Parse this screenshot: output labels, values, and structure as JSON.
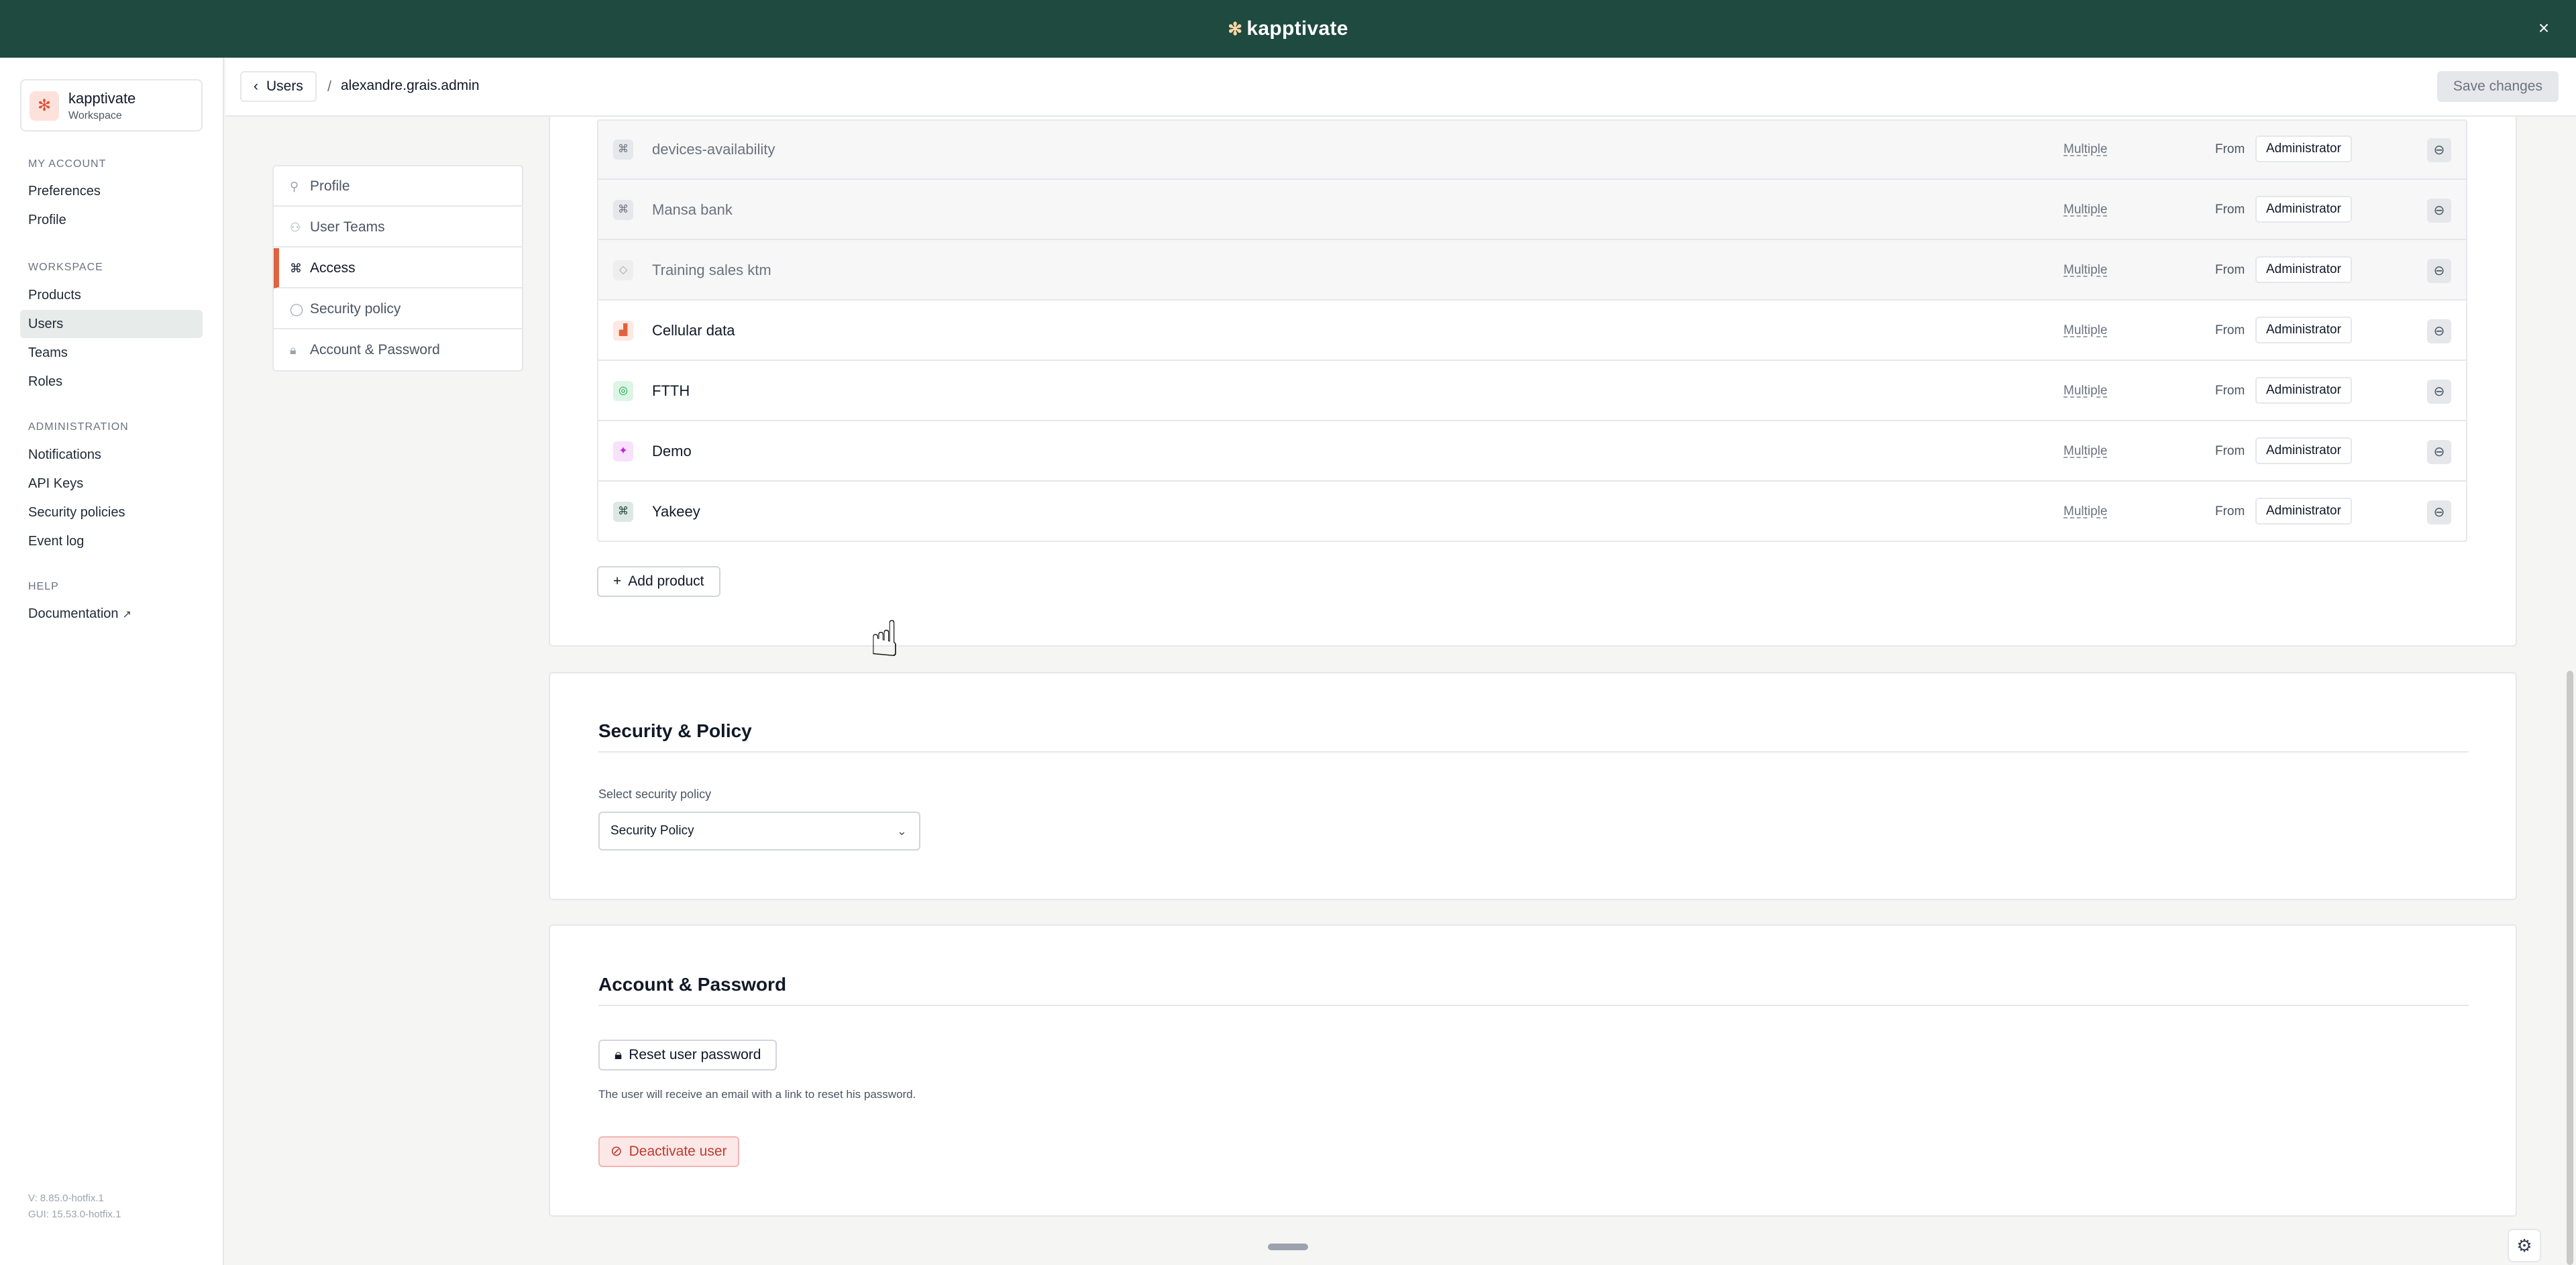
{
  "topbar": {
    "brand": "kapptivate",
    "brand_icon": "asterisk-icon",
    "close_label": "×"
  },
  "sidebar": {
    "workspace": {
      "name": "kapptivate",
      "subtitle": "Workspace"
    },
    "sections": [
      {
        "title": "MY ACCOUNT",
        "items": [
          "Preferences",
          "Profile"
        ]
      },
      {
        "title": "WORKSPACE",
        "items": [
          "Products",
          "Users",
          "Teams",
          "Roles"
        ]
      },
      {
        "title": "ADMINISTRATION",
        "items": [
          "Notifications",
          "API Keys",
          "Security policies",
          "Event log"
        ]
      },
      {
        "title": "HELP",
        "items": [
          "Documentation"
        ]
      }
    ],
    "active_item": "Users",
    "version": "V: 8.85.0-hotfix.1",
    "gui_version": "GUI: 15.53.0-hotfix.1"
  },
  "header": {
    "back_label": "Users",
    "separator": "/",
    "current": "alexandre.grais.admin",
    "save_label": "Save changes"
  },
  "subtabs": [
    {
      "label": "Profile",
      "icon": "user-icon",
      "active": false
    },
    {
      "label": "User Teams",
      "icon": "users-icon",
      "active": false
    },
    {
      "label": "Access",
      "icon": "command-icon",
      "active": true
    },
    {
      "label": "Security policy",
      "icon": "shield-icon",
      "active": false
    },
    {
      "label": "Account & Password",
      "icon": "lock-icon",
      "active": false
    }
  ],
  "products": {
    "rows": [
      {
        "name": "devices-availability",
        "access": "Multiple",
        "from": "From",
        "role": "Administrator",
        "muted": true,
        "icon": "command-icon",
        "icon_color": "#6b7280",
        "icon_bg": "#e5e7eb"
      },
      {
        "name": "Mansa bank",
        "access": "Multiple",
        "from": "From",
        "role": "Administrator",
        "muted": true,
        "icon": "command-icon",
        "icon_color": "#6b7280",
        "icon_bg": "#e5e7eb"
      },
      {
        "name": "Training sales ktm",
        "access": "Multiple",
        "from": "From",
        "role": "Administrator",
        "muted": true,
        "icon": "layers-icon",
        "icon_color": "#9ca3af",
        "icon_bg": "#eeeeee"
      },
      {
        "name": "Cellular data",
        "access": "Multiple",
        "from": "From",
        "role": "Administrator",
        "muted": false,
        "icon": "signal-icon",
        "icon_color": "#e0623f",
        "icon_bg": "#fde8e2"
      },
      {
        "name": "FTTH",
        "access": "Multiple",
        "from": "From",
        "role": "Administrator",
        "muted": false,
        "icon": "globe-icon",
        "icon_color": "#16a34a",
        "icon_bg": "#dcf5e4"
      },
      {
        "name": "Demo",
        "access": "Multiple",
        "from": "From",
        "role": "Administrator",
        "muted": false,
        "icon": "sparkle-icon",
        "icon_color": "#c026d3",
        "icon_bg": "#f8e1fb"
      },
      {
        "name": "Yakeey",
        "access": "Multiple",
        "from": "From",
        "role": "Administrator",
        "muted": false,
        "icon": "command-icon",
        "icon_color": "#1e4a3f",
        "icon_bg": "#dde7e3"
      }
    ],
    "add_label": "Add product"
  },
  "security": {
    "title": "Security & Policy",
    "field_label": "Select security policy",
    "selected": "Security Policy"
  },
  "account": {
    "title": "Account & Password",
    "reset_label": "Reset user password",
    "helper": "The user will receive an email with a link to reset his password.",
    "deactivate_label": "Deactivate user"
  }
}
